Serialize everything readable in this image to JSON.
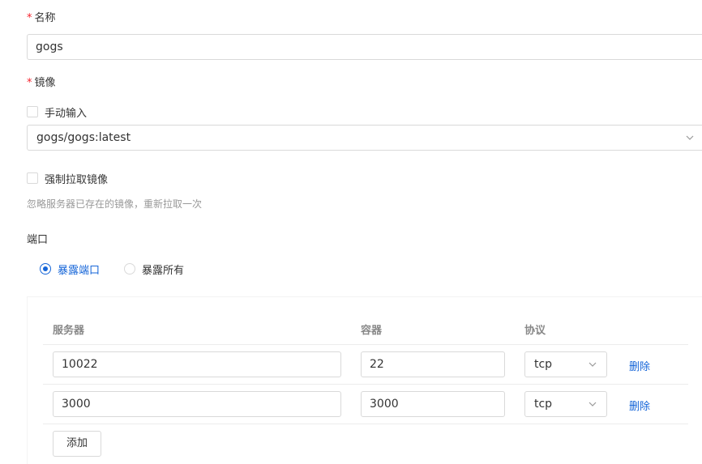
{
  "form": {
    "name": {
      "required_mark": "*",
      "label": "名称",
      "value": "gogs"
    },
    "image": {
      "required_mark": "*",
      "label": "镜像",
      "manual_input_label": "手动输入",
      "selected": "gogs/gogs:latest",
      "force_pull_label": "强制拉取镜像",
      "force_pull_hint": "忽略服务器已存在的镜像，重新拉取一次"
    },
    "ports": {
      "label": "端口",
      "options": [
        {
          "label": "暴露端口",
          "checked": true
        },
        {
          "label": "暴露所有",
          "checked": false
        }
      ],
      "columns": [
        "服务器",
        "容器",
        "协议"
      ],
      "rows": [
        {
          "server": "10022",
          "container": "22",
          "protocol": "tcp",
          "action": "删除"
        },
        {
          "server": "3000",
          "container": "3000",
          "protocol": "tcp",
          "action": "删除"
        }
      ],
      "add_label": "添加"
    }
  },
  "colors": {
    "accent": "#1565d8",
    "required": "#f5222d",
    "border": "#d9d9d9",
    "hint": "#999999"
  }
}
